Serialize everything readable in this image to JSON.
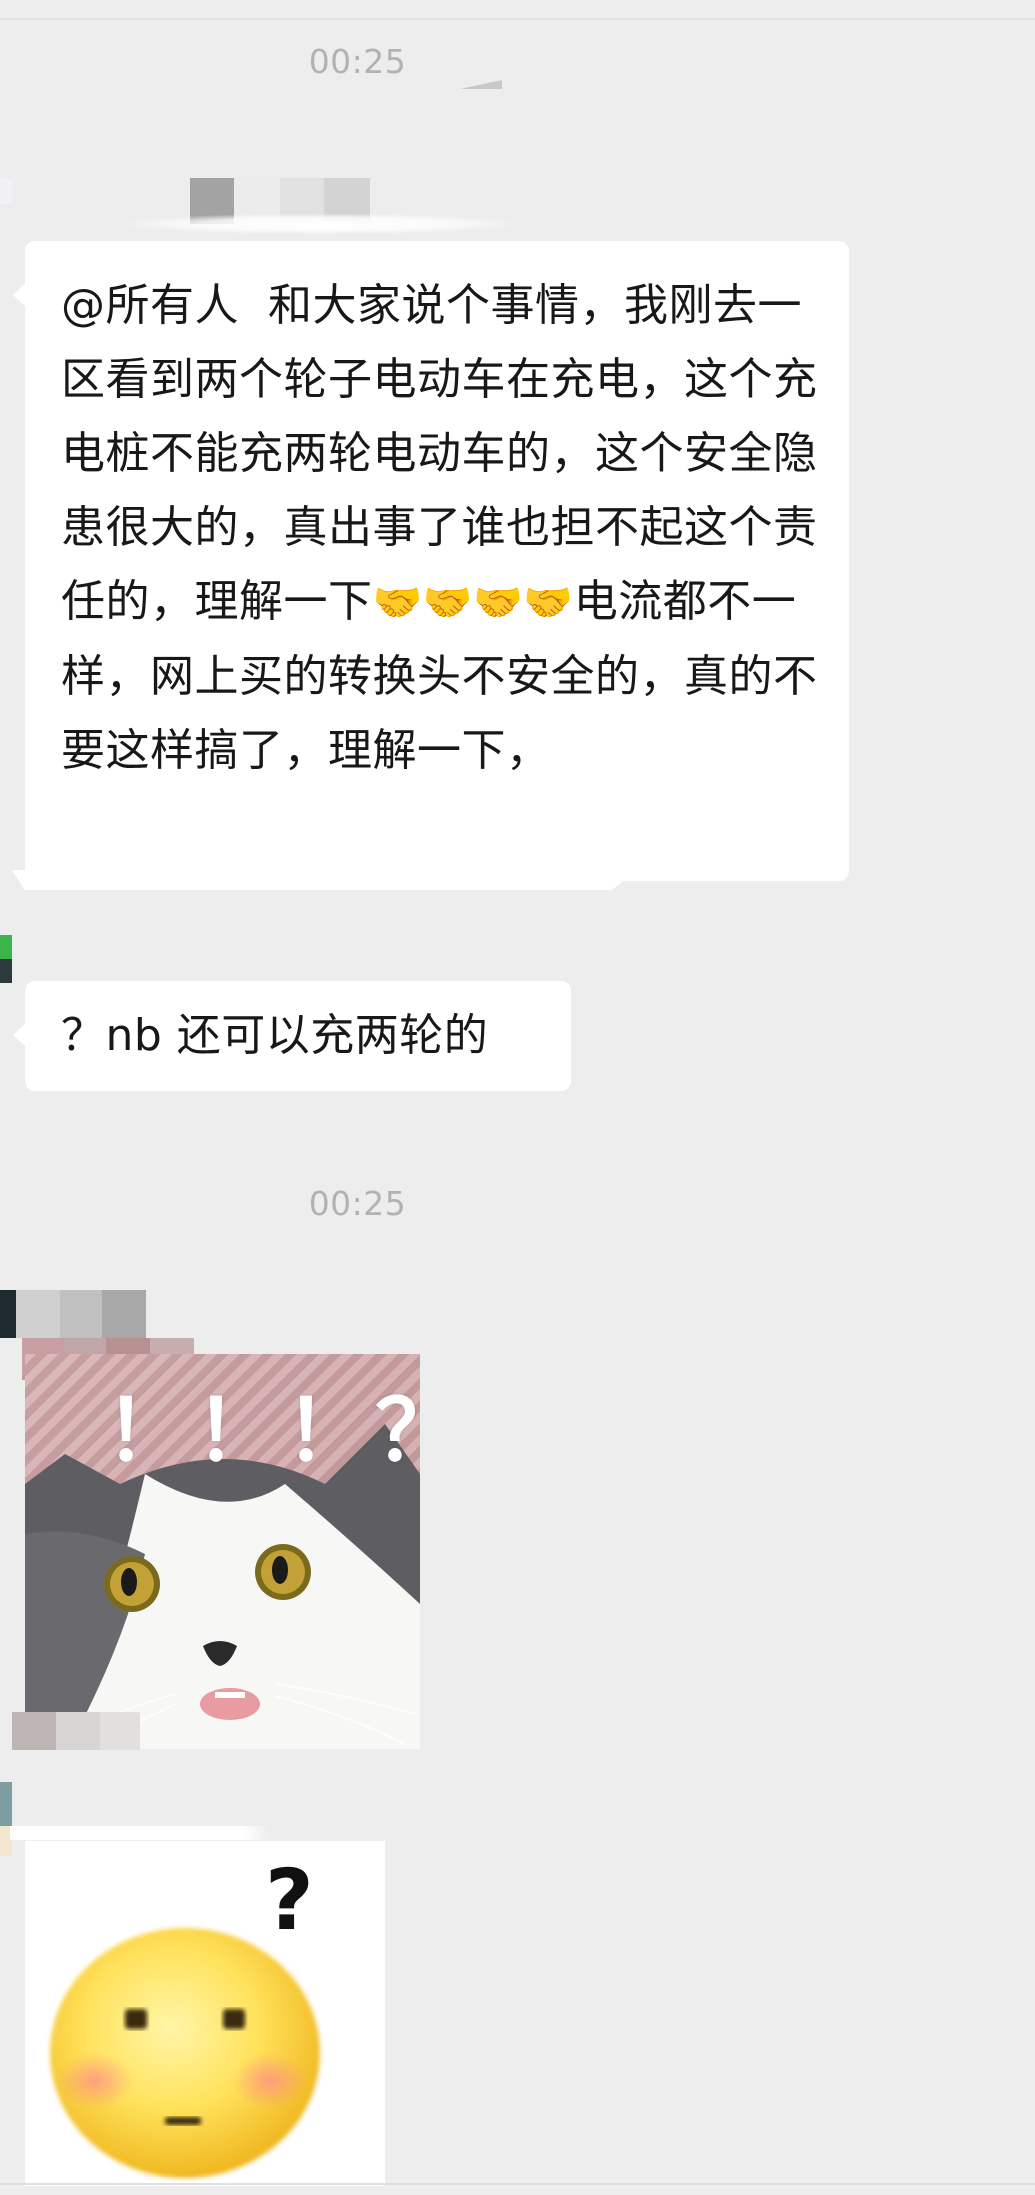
{
  "chat": {
    "timestamp_1": "00:25",
    "timestamp_2": "00:25",
    "messages": [
      {
        "text": "@所有人  和大家说个事情，我刚去一区看到两个轮子电动车在充电，这个充电桩不能充两轮电动车的，这个安全隐患很大的，真出事了谁也担不起这个责任的，理解一下",
        "emoji": "🤝🤝🤝🤝",
        "text_after": "电流都不一样，网上买的转换头不安全的，真的不要这样搞了，理解一下，"
      },
      {
        "text": "？nb 还可以充两轮的"
      }
    ],
    "stickers": [
      {
        "name": "surprised-cat-sticker",
        "caption": "！！！？？"
      },
      {
        "name": "confused-emoji-sticker",
        "caption": "?"
      }
    ]
  },
  "colors": {
    "background": "#ededed",
    "bubble": "#ffffff",
    "timestamp": "#b2b2b2",
    "text": "#181818"
  }
}
